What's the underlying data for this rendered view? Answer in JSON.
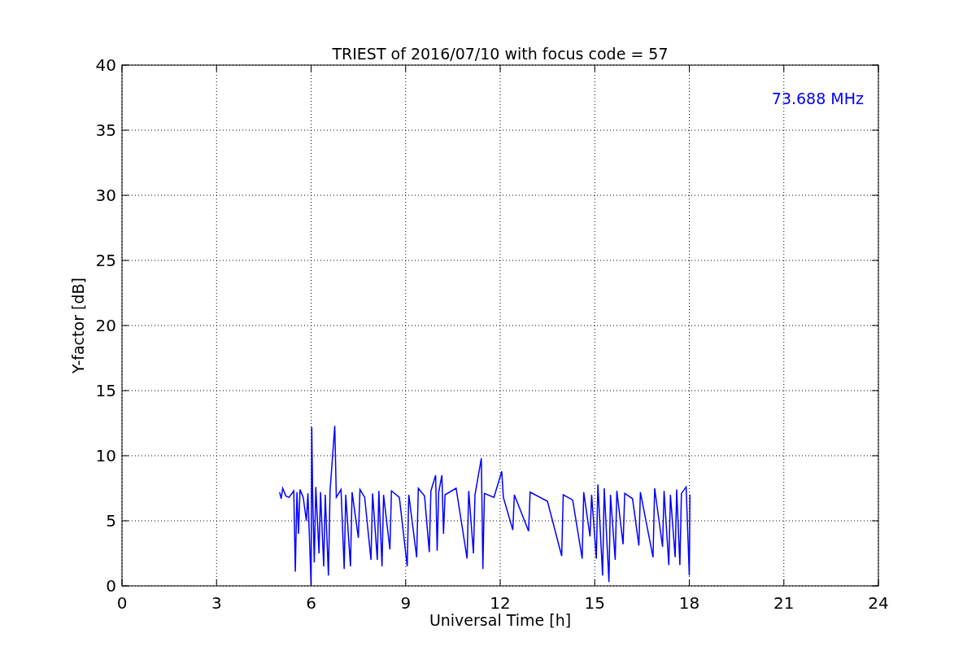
{
  "figure": {
    "chart_data": {
      "type": "line",
      "title": "TRIEST of 2016/07/10 with focus code = 57",
      "xlabel": "Universal Time [h]",
      "ylabel": "Y-factor [dB]",
      "xlim": [
        0,
        24
      ],
      "ylim": [
        0,
        40
      ],
      "xticks": [
        0,
        3,
        6,
        9,
        12,
        15,
        18,
        21,
        24
      ],
      "yticks": [
        0,
        5,
        10,
        15,
        20,
        25,
        30,
        35,
        40
      ],
      "x": [
        5.0,
        5.05,
        5.1,
        5.2,
        5.3,
        5.45,
        5.5,
        5.55,
        5.6,
        5.65,
        5.75,
        5.85,
        5.9,
        6.0,
        6.02,
        6.05,
        6.1,
        6.15,
        6.25,
        6.3,
        6.4,
        6.45,
        6.55,
        6.6,
        6.75,
        6.8,
        6.95,
        7.05,
        7.1,
        7.25,
        7.3,
        7.5,
        7.55,
        7.7,
        7.9,
        7.95,
        8.1,
        8.15,
        8.25,
        8.3,
        8.5,
        8.55,
        8.8,
        9.05,
        9.1,
        9.35,
        9.4,
        9.6,
        9.75,
        9.8,
        9.95,
        10.0,
        10.05,
        10.15,
        10.2,
        10.25,
        10.6,
        10.95,
        11.0,
        11.15,
        11.2,
        11.4,
        11.45,
        11.5,
        11.8,
        12.05,
        12.1,
        12.4,
        12.45,
        12.9,
        12.95,
        13.5,
        13.95,
        14.0,
        14.3,
        14.6,
        14.65,
        14.85,
        14.9,
        15.05,
        15.1,
        15.25,
        15.3,
        15.45,
        15.5,
        15.65,
        15.7,
        15.9,
        15.95,
        16.2,
        16.4,
        16.45,
        16.85,
        16.9,
        17.15,
        17.2,
        17.35,
        17.4,
        17.55,
        17.6,
        17.7,
        17.75,
        17.9,
        18.0,
        18.02
      ],
      "series": [
        {
          "name": "73.688 MHz",
          "color": "#0000ff",
          "values": [
            7.2,
            6.7,
            7.5,
            6.9,
            6.8,
            7.3,
            1.1,
            7.2,
            4.0,
            7.4,
            6.8,
            5.0,
            7.1,
            0,
            12.2,
            7.0,
            1.8,
            7.6,
            2.5,
            7.2,
            1.5,
            7.0,
            0.8,
            7.3,
            12.3,
            6.8,
            7.4,
            1.3,
            7.0,
            1.5,
            7.2,
            3.7,
            7.4,
            6.8,
            2.0,
            7.1,
            2.0,
            7.3,
            1.5,
            7.0,
            2.8,
            7.3,
            6.8,
            1.5,
            7.0,
            2.2,
            7.5,
            6.9,
            2.6,
            7.3,
            8.5,
            2.7,
            7.2,
            8.5,
            4.0,
            7.0,
            7.5,
            2.1,
            7.3,
            2.5,
            7.0,
            9.8,
            1.3,
            7.1,
            6.8,
            8.8,
            6.8,
            4.3,
            7.0,
            4.2,
            7.2,
            6.5,
            2.3,
            7.0,
            6.6,
            2.1,
            7.2,
            3.8,
            7.0,
            2.1,
            7.8,
            0.8,
            7.5,
            0.3,
            7.0,
            2.0,
            7.3,
            3.2,
            7.1,
            6.7,
            3.1,
            7.2,
            2.2,
            7.5,
            3.0,
            7.3,
            1.6,
            7.0,
            2.2,
            7.4,
            1.6,
            7.1,
            7.6,
            0.8,
            7.0
          ]
        }
      ],
      "grid": true
    }
  }
}
